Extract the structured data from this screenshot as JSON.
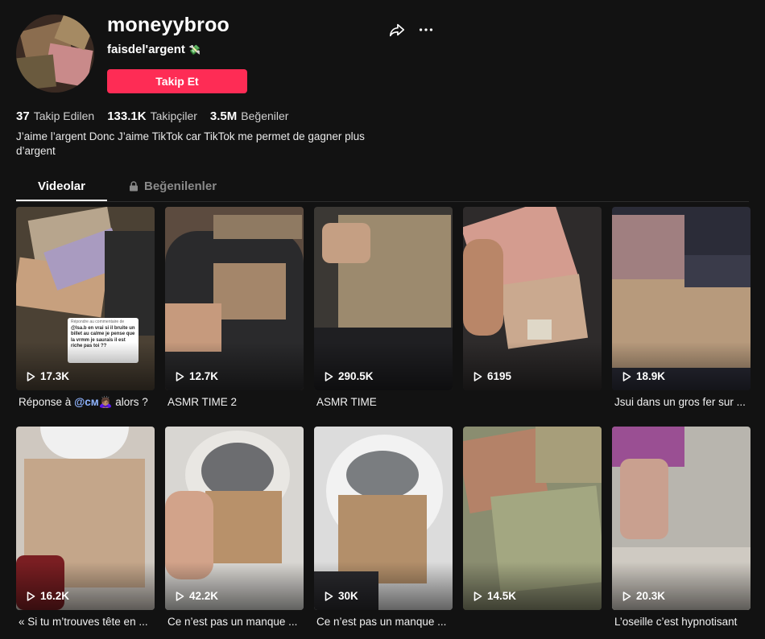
{
  "profile": {
    "username": "moneyybroo",
    "nickname": "faisdel'argent",
    "nickname_emoji": "💸",
    "follow_label": "Takip Et",
    "bio": "J’aime l’argent Donc J’aime TikTok car TikTok me permet de gagner plus d’argent"
  },
  "stats": [
    {
      "value": "37",
      "label": "Takip Edilen"
    },
    {
      "value": "133.1K",
      "label": "Takipçiler"
    },
    {
      "value": "3.5M",
      "label": "Beğeniler"
    }
  ],
  "tabs": {
    "videos": "Videolar",
    "liked": "Beğenilenler"
  },
  "videos": [
    {
      "views": "17.3K",
      "caption_pre": "Réponse à ",
      "mention": "@ᴄᴍ",
      "caption_post": "🙇🏽‍♀️ alors ?",
      "caption": ""
    },
    {
      "views": "12.7K",
      "caption": "ASMR TIME 2"
    },
    {
      "views": "290.5K",
      "caption": "ASMR TIME"
    },
    {
      "views": "6195",
      "caption": ""
    },
    {
      "views": "18.9K",
      "caption": "Jsui dans un gros fer sur ..."
    },
    {
      "views": "16.2K",
      "caption": "« Si tu m’trouves tête en ..."
    },
    {
      "views": "42.2K",
      "caption": "Ce n’est pas un manque ..."
    },
    {
      "views": "30K",
      "caption": "Ce n’est pas un manque ..."
    },
    {
      "views": "14.5K",
      "caption": ""
    },
    {
      "views": "20.3K",
      "caption": "L’oseille c’est hypnotisant"
    }
  ],
  "overlay": {
    "title": "Répondre au commentaire de",
    "text": "@lsa.b en vrai si il bruite un billet au calme je pense que la vrmm je saurais il est riche pas toi ??"
  },
  "colors": {
    "accent": "#fe2c55",
    "background": "#121212"
  }
}
